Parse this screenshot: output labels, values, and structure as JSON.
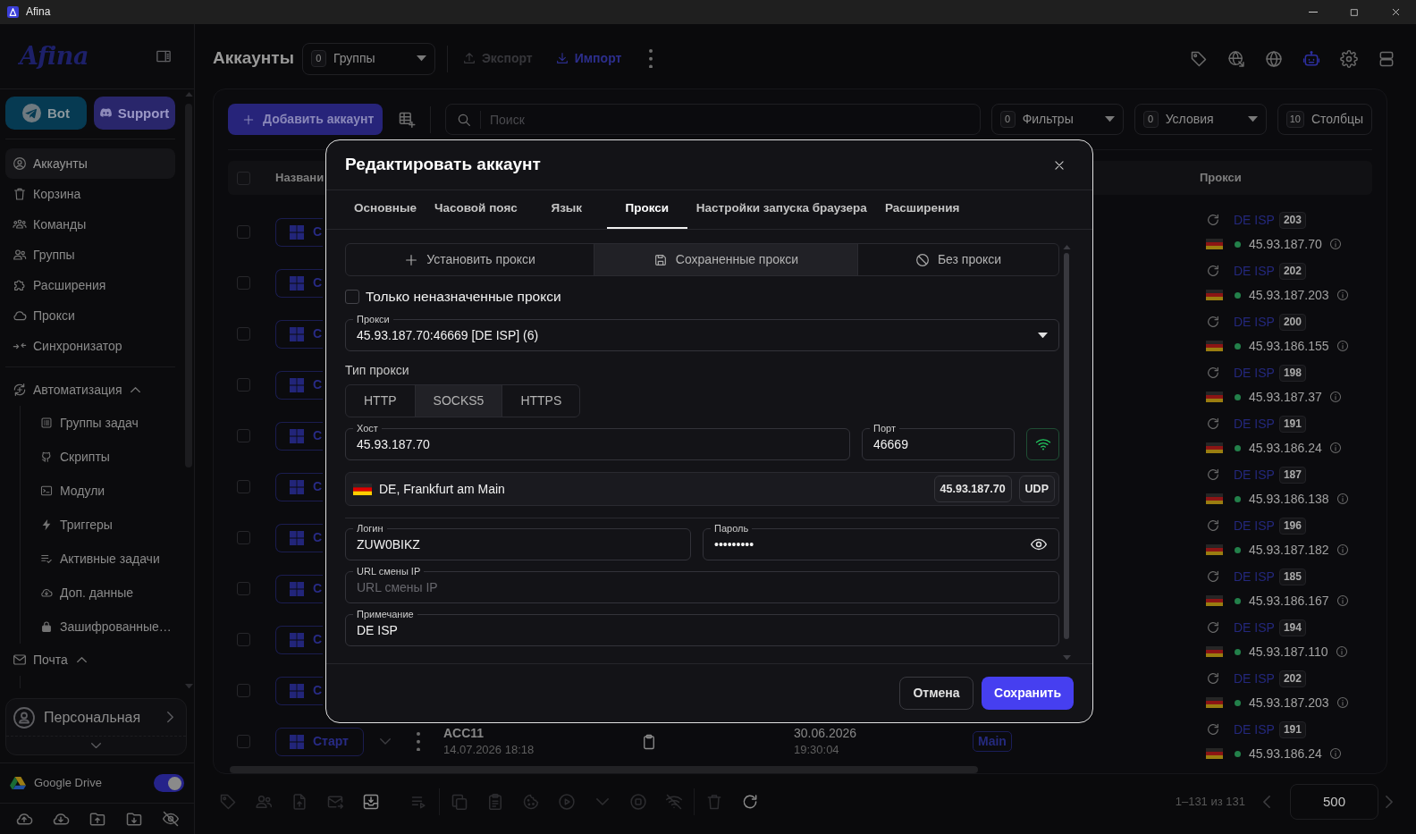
{
  "window": {
    "title": "Afina"
  },
  "sidebar": {
    "logo": "Afina",
    "buttons": [
      {
        "label": "Bot"
      },
      {
        "label": "Support"
      }
    ],
    "nav": [
      {
        "label": "Аккаунты",
        "selected": true
      },
      {
        "label": "Корзина",
        "selected": false
      },
      {
        "label": "Команды",
        "selected": false
      },
      {
        "label": "Группы",
        "selected": false
      },
      {
        "label": "Расширения",
        "selected": false
      },
      {
        "label": "Прокси",
        "selected": false
      },
      {
        "label": "Синхронизатор",
        "selected": false
      }
    ],
    "sections": [
      {
        "label": "Автоматизация",
        "expanded": true,
        "children": [
          {
            "label": "Группы задач",
            "selected": false
          },
          {
            "label": "Скрипты",
            "selected": false
          },
          {
            "label": "Модули",
            "selected": false
          },
          {
            "label": "Триггеры",
            "selected": false
          },
          {
            "label": "Активные задачи",
            "selected": false
          },
          {
            "label": "Доп. данные",
            "selected": false
          },
          {
            "label": "Зашифрованные…",
            "selected": false
          }
        ]
      },
      {
        "label": "Почта",
        "expanded": true
      }
    ],
    "workspace": {
      "label": "Персональная"
    },
    "cloud": {
      "label": "Google Drive",
      "on": true
    }
  },
  "header": {
    "title": "Аккаунты",
    "groups": {
      "count": "0",
      "label": "Группы"
    },
    "actions": [
      {
        "label": "Экспорт",
        "disabled": true
      },
      {
        "label": "Импорт",
        "disabled": false
      }
    ],
    "tools": [
      {
        "selected": false
      },
      {
        "selected": false
      },
      {
        "selected": false
      },
      {
        "selected": true
      },
      {
        "selected": false
      },
      {
        "selected": false
      }
    ]
  },
  "toolbar": {
    "add_label": "Добавить аккаунт",
    "search_placeholder": "Поиск",
    "filters": [
      {
        "kind": "dropdown",
        "count": "0",
        "label": "Фильтры"
      },
      {
        "kind": "dropdown",
        "count": "0",
        "label": "Условия"
      },
      {
        "kind": "button",
        "count": "10",
        "label": "Столбцы"
      }
    ]
  },
  "table": {
    "all_checked": false,
    "columns": [
      "Названи",
      "Прокси"
    ],
    "rows": [
      {
        "checked": false,
        "start_label": "С",
        "proxy": {
          "name": "DE ISP",
          "count": "203",
          "ip": "45.93.187.70",
          "online": true
        }
      },
      {
        "checked": false,
        "start_label": "С",
        "proxy": {
          "name": "DE ISP",
          "count": "202",
          "ip": "45.93.187.203",
          "online": true
        }
      },
      {
        "checked": false,
        "start_label": "С",
        "proxy": {
          "name": "DE ISP",
          "count": "200",
          "ip": "45.93.186.155",
          "online": true
        }
      },
      {
        "checked": false,
        "start_label": "С",
        "proxy": {
          "name": "DE ISP",
          "count": "198",
          "ip": "45.93.187.37",
          "online": true
        }
      },
      {
        "checked": false,
        "start_label": "С",
        "proxy": {
          "name": "DE ISP",
          "count": "191",
          "ip": "45.93.186.24",
          "online": true
        }
      },
      {
        "checked": false,
        "start_label": "С",
        "proxy": {
          "name": "DE ISP",
          "count": "187",
          "ip": "45.93.186.138",
          "online": true
        }
      },
      {
        "checked": false,
        "start_label": "С",
        "proxy": {
          "name": "DE ISP",
          "count": "196",
          "ip": "45.93.187.182",
          "online": true
        }
      },
      {
        "checked": false,
        "start_label": "С",
        "proxy": {
          "name": "DE ISP",
          "count": "185",
          "ip": "45.93.186.167",
          "online": true
        }
      },
      {
        "checked": false,
        "start_label": "С",
        "proxy": {
          "name": "DE ISP",
          "count": "194",
          "ip": "45.93.187.110",
          "online": true
        }
      },
      {
        "checked": false,
        "start_label": "С",
        "proxy": {
          "name": "DE ISP",
          "count": "202",
          "ip": "45.93.187.203",
          "online": true
        }
      },
      {
        "checked": false,
        "start_label": "Старт",
        "title": "ACC11",
        "subtitle": "14.07.2026 18:18",
        "date": "30.06.2026",
        "time": "19:30:04",
        "tag": "Main",
        "proxy": {
          "name": "DE ISP",
          "count": "191",
          "ip": "45.93.186.24",
          "online": true
        }
      }
    ]
  },
  "pager": {
    "actions": [
      {
        "disabled": true
      },
      {
        "disabled": true
      },
      {
        "disabled": true
      },
      {
        "disabled": true
      },
      {
        "disabled": false
      },
      {
        "disabled": true
      },
      {
        "disabled": true
      },
      {
        "disabled": true
      },
      {
        "disabled": true
      },
      {
        "disabled": true
      },
      {
        "disabled": true
      },
      {
        "disabled": true
      },
      {
        "disabled": true
      },
      {
        "disabled": true
      },
      {
        "disabled": false
      }
    ],
    "range": "1–131 из 131",
    "prev_disabled": true,
    "next_disabled": true,
    "page_size": "500"
  },
  "modal": {
    "title": "Редактировать аккаунт",
    "tabs": [
      {
        "label": "Основные",
        "selected": false
      },
      {
        "label": "Часовой пояс",
        "selected": false
      },
      {
        "label": "Язык",
        "selected": false
      },
      {
        "label": "Прокси",
        "selected": true
      },
      {
        "label": "Настройки запуска браузера",
        "selected": false
      },
      {
        "label": "Расширения",
        "selected": false
      }
    ],
    "modes": [
      {
        "label": "Установить прокси",
        "selected": false
      },
      {
        "label": "Сохраненные прокси",
        "selected": true
      },
      {
        "label": "Без прокси",
        "selected": false
      }
    ],
    "unassigned_only": {
      "label": "Только неназначенные прокси",
      "checked": false
    },
    "proxy_select": {
      "label": "Прокси",
      "value": "45.93.187.70:46669 [DE ISP] (6)"
    },
    "proxy_type": {
      "label": "Тип прокси",
      "options": [
        {
          "label": "HTTP",
          "selected": false
        },
        {
          "label": "SOCKS5",
          "selected": true
        },
        {
          "label": "HTTPS",
          "selected": false
        }
      ]
    },
    "host": {
      "label": "Хост",
      "value": "45.93.187.70"
    },
    "port": {
      "label": "Порт",
      "value": "46669"
    },
    "geo": {
      "location": "DE, Frankfurt am Main",
      "ip": "45.93.187.70",
      "protocol": "UDP"
    },
    "login": {
      "label": "Логин",
      "value": "ZUW0BIKZ"
    },
    "password": {
      "label": "Пароль",
      "value": "•••••••••"
    },
    "ip_change_url": {
      "label": "URL смены IP",
      "placeholder": "URL смены IP"
    },
    "note": {
      "label": "Примечание",
      "value": "DE ISP"
    },
    "buttons": [
      {
        "label": "Отмена",
        "kind": "secondary"
      },
      {
        "label": "Сохранить",
        "kind": "primary"
      }
    ]
  }
}
